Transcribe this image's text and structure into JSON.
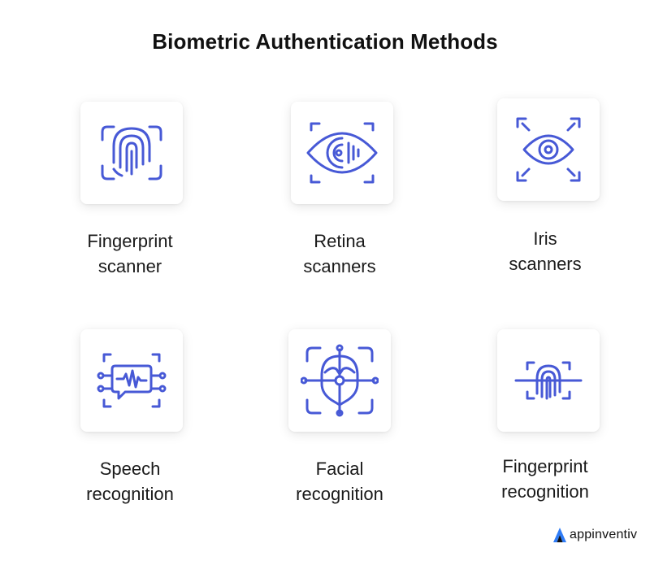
{
  "title": "Biometric Authentication Methods",
  "colors": {
    "icon": "#4759d6",
    "dot": "#4759d6",
    "text": "#111111",
    "logo_blue": "#2f7cf6"
  },
  "methods": [
    {
      "icon": "fingerprint-icon",
      "line1": "Fingerprint",
      "line2": "scanner"
    },
    {
      "icon": "retina-eye-icon",
      "line1": "Retina",
      "line2": "scanners"
    },
    {
      "icon": "iris-eye-icon",
      "line1": "Iris",
      "line2": "scanners"
    },
    {
      "icon": "speech-wave-icon",
      "line1": "Speech",
      "line2": "recognition"
    },
    {
      "icon": "face-scan-icon",
      "line1": "Facial",
      "line2": "recognition"
    },
    {
      "icon": "fingerprint-scan-icon",
      "line1": "Fingerprint",
      "line2": "recognition"
    }
  ],
  "brand": {
    "name": "appinventiv",
    "icon": "appinventiv-logo-icon"
  }
}
